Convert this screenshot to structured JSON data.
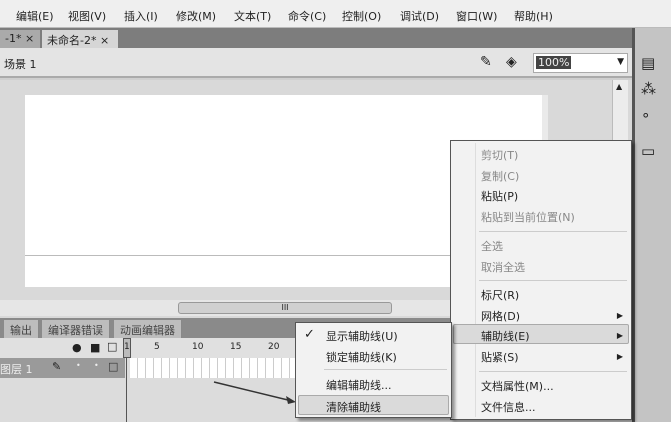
{
  "menubar": [
    "编辑(E)",
    "视图(V)",
    "插入(I)",
    "修改(M)",
    "文本(T)",
    "命令(C)",
    "控制(O)",
    "调试(D)",
    "窗口(W)",
    "帮助(H)"
  ],
  "tabs": [
    {
      "label": "-1*",
      "close": "×"
    },
    {
      "label": "未命名-2*",
      "close": "×"
    }
  ],
  "scene": {
    "label": "场景 1",
    "zoom": "100%"
  },
  "hscroll_grip": "III",
  "panel_tabs": [
    "输出",
    "编译器错误",
    "动画编辑器"
  ],
  "timeline": {
    "frame_numbers": [
      "1",
      "5",
      "10",
      "15",
      "20"
    ],
    "layer": "图层 1"
  },
  "context_menu": [
    {
      "label": "剪切(T)",
      "disabled": true
    },
    {
      "label": "复制(C)",
      "disabled": true
    },
    {
      "label": "粘贴(P)"
    },
    {
      "label": "粘贴到当前位置(N)",
      "disabled": true
    },
    {
      "label": "全选",
      "disabled": true
    },
    {
      "label": "取消全选",
      "disabled": true
    },
    {
      "label": "标尺(R)"
    },
    {
      "label": "网格(D)",
      "submenu": true
    },
    {
      "label": "辅助线(E)",
      "submenu": true,
      "highlighted": true
    },
    {
      "label": "贴紧(S)",
      "submenu": true
    },
    {
      "label": "文档属性(M)..."
    },
    {
      "label": "文件信息..."
    }
  ],
  "submenu": [
    {
      "label": "显示辅助线(U)",
      "checked": true,
      "check": "✓"
    },
    {
      "label": "锁定辅助线(K)"
    },
    {
      "label": "编辑辅助线..."
    },
    {
      "label": "清除辅助线",
      "highlighted": true
    }
  ]
}
